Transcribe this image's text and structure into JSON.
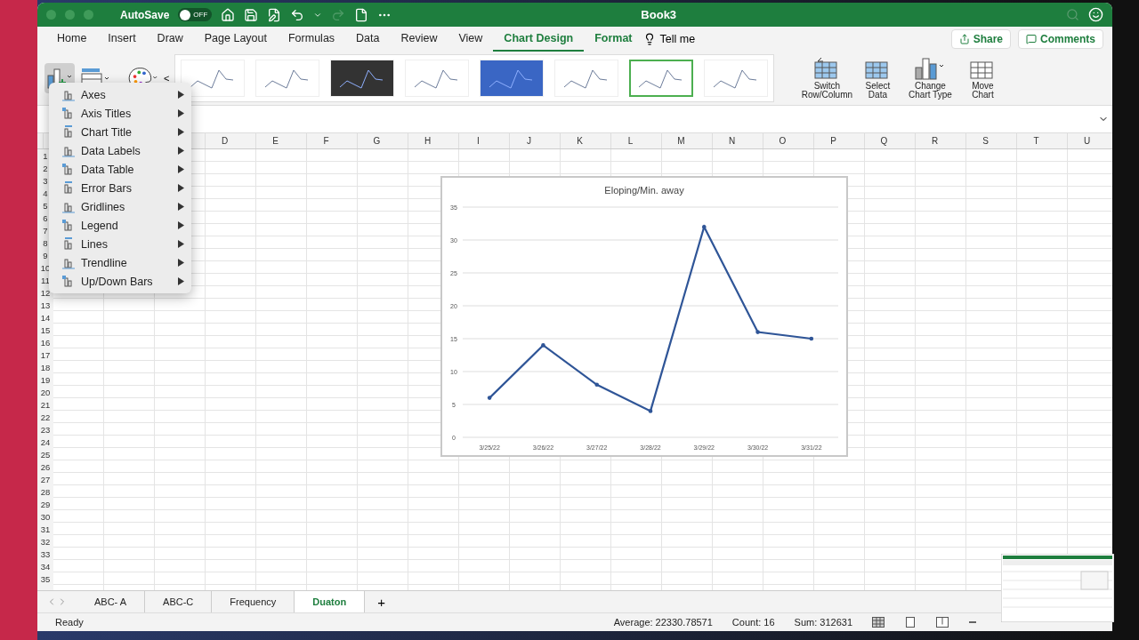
{
  "window": {
    "title": "Book3",
    "autosave": {
      "label": "AutoSave",
      "on": false,
      "state_label": "OFF"
    },
    "redo_disabled": true
  },
  "tabs": [
    {
      "label": "Home",
      "selected": false,
      "contextual": false
    },
    {
      "label": "Insert",
      "selected": false,
      "contextual": false
    },
    {
      "label": "Draw",
      "selected": false,
      "contextual": false
    },
    {
      "label": "Page Layout",
      "selected": false,
      "contextual": false
    },
    {
      "label": "Formulas",
      "selected": false,
      "contextual": false
    },
    {
      "label": "Data",
      "selected": false,
      "contextual": false
    },
    {
      "label": "Review",
      "selected": false,
      "contextual": false
    },
    {
      "label": "View",
      "selected": false,
      "contextual": false
    },
    {
      "label": "Chart Design",
      "selected": true,
      "contextual": true
    },
    {
      "label": "Format",
      "selected": false,
      "contextual": true
    }
  ],
  "tell_me": "Tell me",
  "share_button": "Share",
  "comments_button": "Comments",
  "ribbon": {
    "add_element_pressed": true,
    "gallery_prev": "<",
    "chart_styles": [
      {
        "kind": "light",
        "selected": false
      },
      {
        "kind": "light",
        "selected": false
      },
      {
        "kind": "dark",
        "selected": false
      },
      {
        "kind": "light",
        "selected": false
      },
      {
        "kind": "blue",
        "selected": false
      },
      {
        "kind": "light",
        "selected": false
      },
      {
        "kind": "light",
        "selected": true
      },
      {
        "kind": "light",
        "selected": false
      }
    ],
    "buttons": [
      {
        "kind": "switch",
        "label": "Switch Row/Column"
      },
      {
        "kind": "select",
        "label": "Select Data"
      },
      {
        "kind": "type",
        "label": "Change Chart Type"
      },
      {
        "kind": "move",
        "label": "Move Chart"
      }
    ]
  },
  "add_chart_element_menu": [
    "Axes",
    "Axis Titles",
    "Chart Title",
    "Data Labels",
    "Data Table",
    "Error Bars",
    "Gridlines",
    "Legend",
    "Lines",
    "Trendline",
    "Up/Down Bars"
  ],
  "columns": [
    "D",
    "E",
    "F",
    "G",
    "H",
    "I",
    "J",
    "K",
    "L",
    "M",
    "N",
    "O",
    "P",
    "Q",
    "R",
    "S",
    "T",
    "U"
  ],
  "rows": [
    "1",
    "2",
    "3",
    "4",
    "5",
    "6",
    "7",
    "8",
    "9",
    "10",
    "11",
    "12",
    "13",
    "14",
    "15",
    "16",
    "17",
    "18",
    "19",
    "20",
    "21",
    "22",
    "23",
    "24",
    "25",
    "26",
    "27",
    "28",
    "29",
    "30",
    "31",
    "32",
    "33",
    "34",
    "35"
  ],
  "chart": {
    "chart_data": {
      "type": "line",
      "title": "Eloping/Min. away",
      "categories": [
        "3/25/22",
        "3/26/22",
        "3/27/22",
        "3/28/22",
        "3/29/22",
        "3/30/22",
        "3/31/22"
      ],
      "series": [
        {
          "color": "#2f5597",
          "values": [
            6,
            14,
            8,
            4,
            32,
            16,
            15
          ]
        }
      ],
      "grid": true,
      "ylim": [
        0,
        35
      ],
      "yticks": [
        0,
        5,
        10,
        15,
        20,
        25,
        30,
        35
      ]
    }
  },
  "sheet_tabs": [
    {
      "label": "ABC- A",
      "selected": false
    },
    {
      "label": "ABC-C",
      "selected": false
    },
    {
      "label": "Frequency",
      "selected": false
    },
    {
      "label": "Duaton",
      "selected": true
    }
  ],
  "add_sheet": "+",
  "status_bar": {
    "status": "Ready",
    "average": "Average: 22330.78571",
    "count": "Count: 16",
    "sum": "Sum: 312631"
  }
}
